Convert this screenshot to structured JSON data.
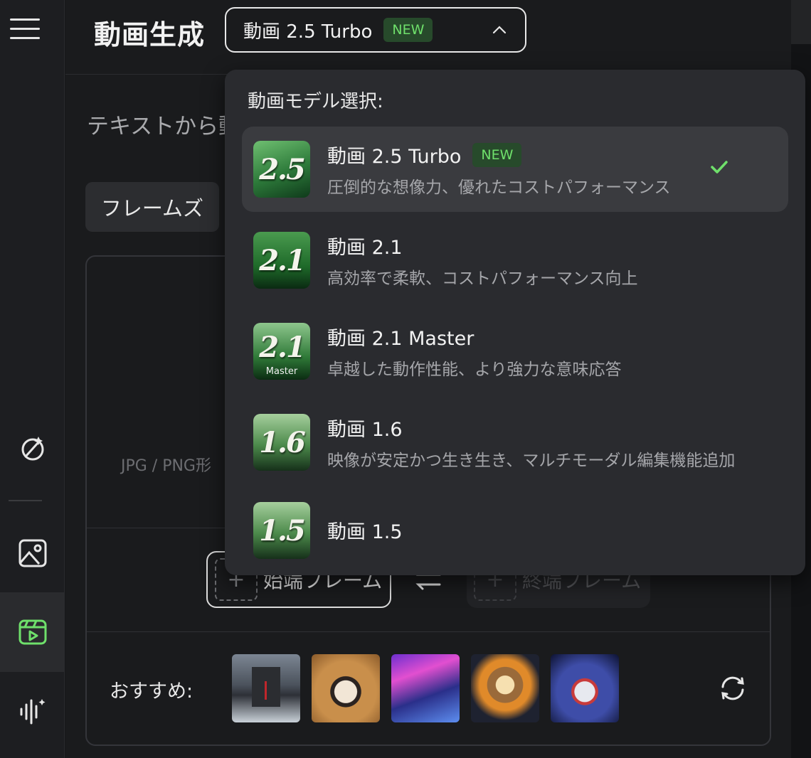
{
  "header": {
    "title": "動画生成",
    "model_select": {
      "label": "動画 2.5 Turbo",
      "badge": "NEW"
    }
  },
  "main": {
    "subtitle": "テキストから動",
    "frames_tab": "フレームズ",
    "upload_hint": "JPG / PNG形",
    "start_frame": "始端フレーム",
    "end_frame": "終端フレーム",
    "plus": "+",
    "recommend_label": "おすすめ:"
  },
  "dropdown": {
    "title": "動画モデル選択:",
    "options": [
      {
        "name": "動画 2.5 Turbo",
        "badge": "NEW",
        "desc": "圧倒的な想像力、優れたコストパフォーマンス",
        "logo": "2.5",
        "selected": true
      },
      {
        "name": "動画 2.1",
        "desc": "高効率で柔軟、コストパフォーマンス向上",
        "logo": "2.1"
      },
      {
        "name": "動画 2.1 Master",
        "desc": "卓越した動作性能、より強力な意味応答",
        "logo": "2.1",
        "logo_sub": "Master"
      },
      {
        "name": "動画 1.6",
        "desc": "映像が安定かつ生き生き、マルチモーダル編集機能追加",
        "logo": "1.6"
      },
      {
        "name": "動画 1.5",
        "logo": "1.5"
      }
    ]
  },
  "colors": {
    "accent_green": "#6fe06b",
    "badge_bg": "#274a2b"
  }
}
